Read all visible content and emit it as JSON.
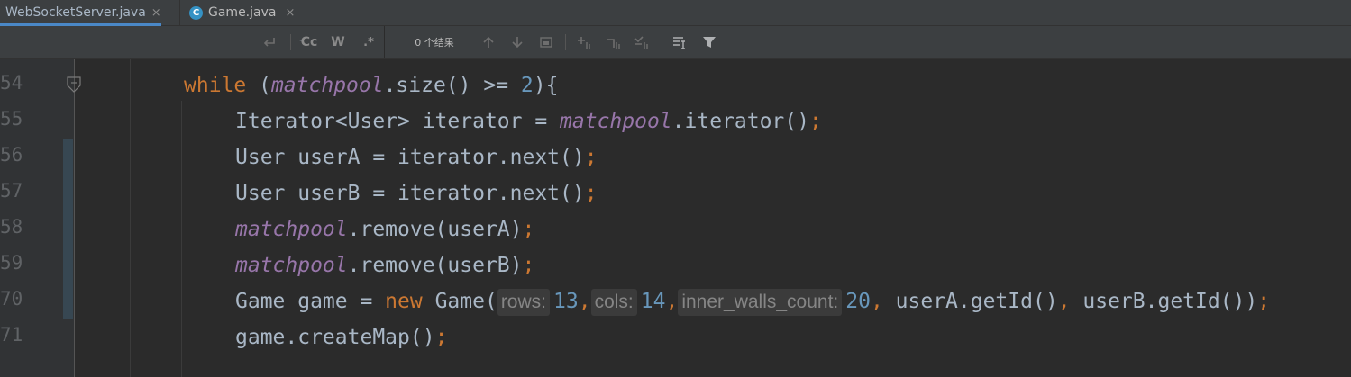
{
  "tabs": [
    {
      "label": "WebSocketServer.java",
      "active": true,
      "close": "×"
    },
    {
      "label": "Game.java",
      "active": false,
      "icon": "C",
      "close": "×"
    }
  ],
  "find_toolbar": {
    "results_text": "0 个结果",
    "match_case_label": "Cc",
    "words_label": "W",
    "regex_label": ".*"
  },
  "gutter": {
    "line_numbers": [
      "54",
      "55",
      "56",
      "57",
      "58",
      "59",
      "70",
      "71"
    ]
  },
  "code": {
    "partial_top": "    ·.·  (   ·     ·   · ·);",
    "l64": {
      "kw": "while",
      "p1": " (",
      "fld": "matchpool",
      "p2": ".size() >= ",
      "num": "2",
      "p3": "){"
    },
    "l65": {
      "p1": "Iterator<User> iterator = ",
      "fld": "matchpool",
      "p2": ".iterator()",
      "semi": ";"
    },
    "l66": {
      "p1": "User userA = iterator.next()",
      "semi": ";"
    },
    "l67": {
      "p1": "User userB = iterator.next()",
      "semi": ";"
    },
    "l68": {
      "fld": "matchpool",
      "p1": ".remove(userA)",
      "semi": ";"
    },
    "l69": {
      "fld": "matchpool",
      "p1": ".remove(userB)",
      "semi": ";"
    },
    "l70": {
      "p1": "Game game = ",
      "kw": "new",
      "p2": " Game(",
      "hint1": "rows:",
      "n1": "13",
      "c1": ",",
      "hint2": "cols:",
      "n2": "14",
      "c2": ",",
      "hint3": "inner_walls_count:",
      "n3": "20",
      "c3": ",",
      "p3": " userA.getId()",
      "c4": ",",
      "p4": " userB.getId())",
      "semi": ";"
    },
    "l71": {
      "p1": "game.createMap()",
      "semi": ";"
    }
  },
  "colors": {
    "background": "#2b2b2b",
    "keyword": "#cc7832",
    "field": "#9876aa",
    "number": "#6897bb",
    "text": "#a9b7c6",
    "line_number": "#606366",
    "active_tab_underline": "#4a88c7"
  }
}
